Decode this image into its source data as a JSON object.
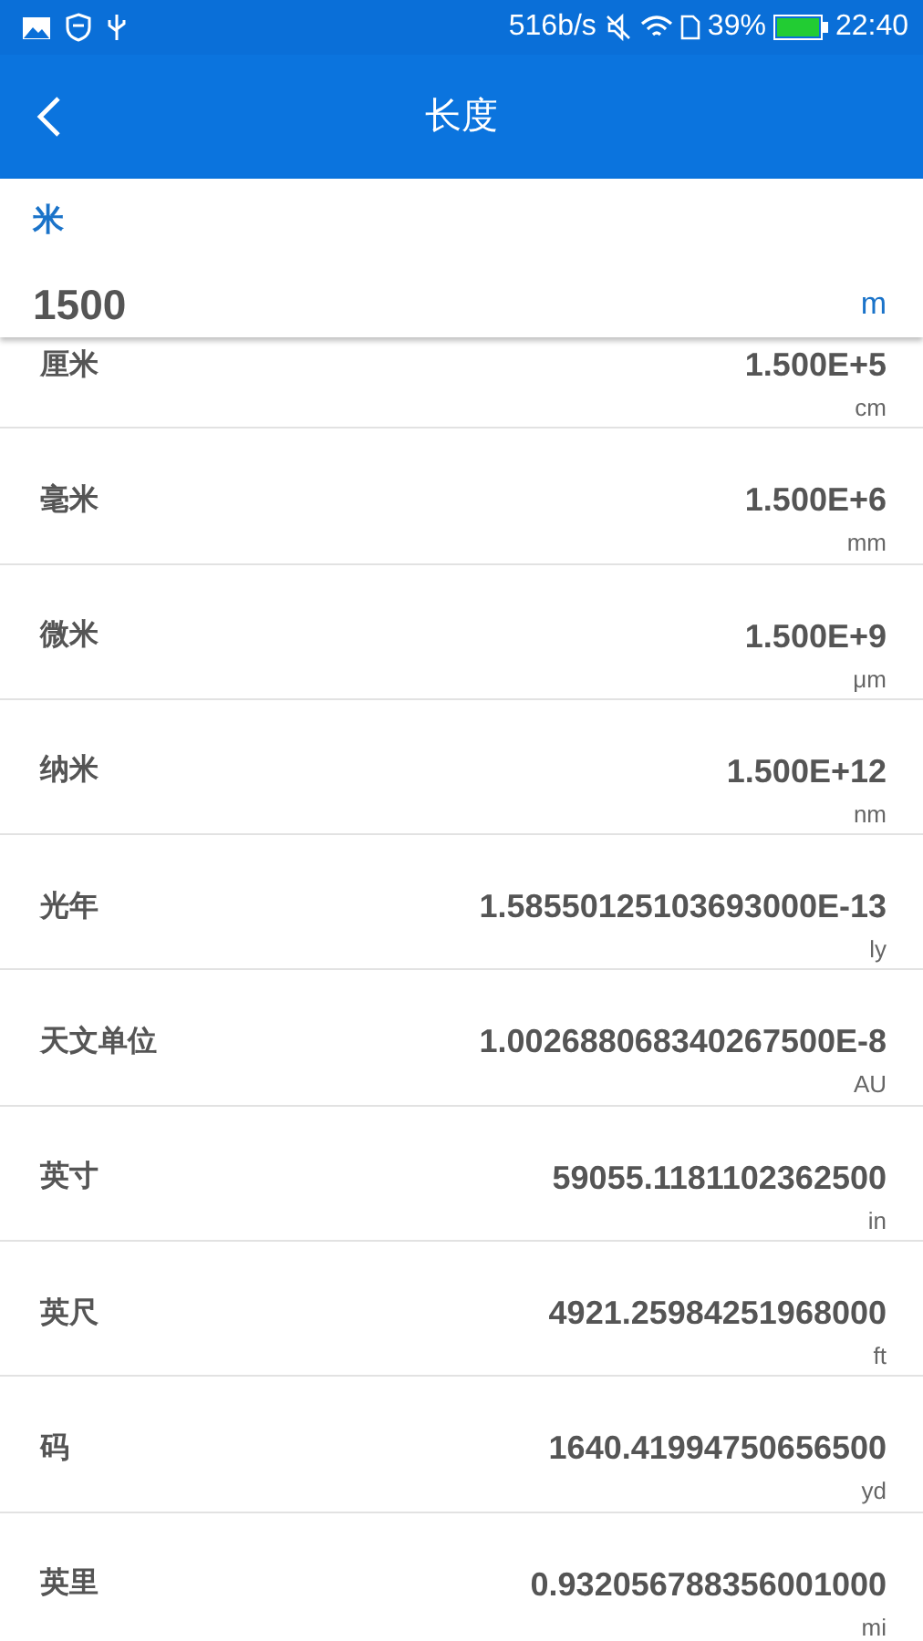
{
  "status_bar": {
    "speed": "516b/s",
    "battery": "39%",
    "time": "22:40"
  },
  "toolbar": {
    "title": "长度"
  },
  "input": {
    "label": "米",
    "value": "1500",
    "unit": "m"
  },
  "results": [
    {
      "name": "厘米",
      "value": "1.500E+5",
      "unit": "cm"
    },
    {
      "name": "毫米",
      "value": "1.500E+6",
      "unit": "mm"
    },
    {
      "name": "微米",
      "value": "1.500E+9",
      "unit": "μm"
    },
    {
      "name": "纳米",
      "value": "1.500E+12",
      "unit": "nm"
    },
    {
      "name": "光年",
      "value": "1.58550125103693000E-13",
      "unit": "ly"
    },
    {
      "name": "天文单位",
      "value": "1.002688068340267500E-8",
      "unit": "AU"
    },
    {
      "name": "英寸",
      "value": "59055.1181102362500",
      "unit": "in"
    },
    {
      "name": "英尺",
      "value": "4921.25984251968000",
      "unit": "ft"
    },
    {
      "name": "码",
      "value": "1640.41994750656500",
      "unit": "yd"
    },
    {
      "name": "英里",
      "value": "0.932056788356001000",
      "unit": "mi"
    }
  ]
}
